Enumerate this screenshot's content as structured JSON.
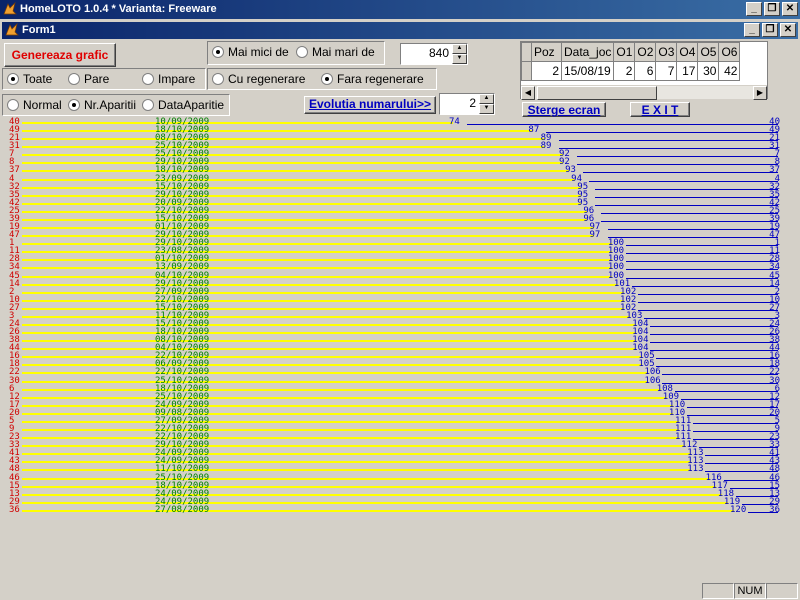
{
  "app": {
    "title": "HomeLOTO 1.0.4 * Varianta: Freeware"
  },
  "form": {
    "title": "Form1"
  },
  "controls": {
    "generate_label": "Genereaza grafic",
    "filter_options": [
      "Toate",
      "Pare",
      "Impare"
    ],
    "compare_options": [
      "Mai mici de",
      "Mai mari de"
    ],
    "threshold_value": "840",
    "regen_options": [
      "Cu regenerare",
      "Fara regenerare"
    ],
    "sort_options": [
      "Normal",
      "Nr.Aparitii",
      "DataAparitie"
    ],
    "evolution_label": "Evolutia numarului>>",
    "evolution_value": "2",
    "clear_label": "Sterge ecran",
    "exit_label": "E X I T"
  },
  "grid": {
    "headers": [
      "Poz",
      "Data_joc",
      "O1",
      "O2",
      "O3",
      "O4",
      "O5",
      "O6"
    ],
    "row": [
      "2",
      "15/08/19",
      "2",
      "6",
      "7",
      "17",
      "30",
      "42"
    ]
  },
  "chart_data": {
    "type": "bar",
    "rows": [
      {
        "n": "40",
        "date": "10/09/2009",
        "count": 74
      },
      {
        "n": "49",
        "date": "18/10/2009",
        "count": 87
      },
      {
        "n": "21",
        "date": "08/10/2009",
        "count": 89
      },
      {
        "n": "31",
        "date": "25/10/2009",
        "count": 89
      },
      {
        "n": "7",
        "date": "25/10/2009",
        "count": 92
      },
      {
        "n": "8",
        "date": "29/10/2009",
        "count": 92
      },
      {
        "n": "37",
        "date": "18/10/2009",
        "count": 93
      },
      {
        "n": "4",
        "date": "23/09/2009",
        "count": 94
      },
      {
        "n": "32",
        "date": "15/10/2009",
        "count": 95
      },
      {
        "n": "35",
        "date": "29/10/2009",
        "count": 95
      },
      {
        "n": "42",
        "date": "20/09/2009",
        "count": 95
      },
      {
        "n": "25",
        "date": "22/10/2009",
        "count": 96
      },
      {
        "n": "39",
        "date": "15/10/2009",
        "count": 96
      },
      {
        "n": "19",
        "date": "01/10/2009",
        "count": 97
      },
      {
        "n": "47",
        "date": "29/10/2009",
        "count": 97
      },
      {
        "n": "1",
        "date": "29/10/2009",
        "count": 100
      },
      {
        "n": "11",
        "date": "23/08/2009",
        "count": 100
      },
      {
        "n": "28",
        "date": "01/10/2009",
        "count": 100
      },
      {
        "n": "34",
        "date": "13/09/2009",
        "count": 100
      },
      {
        "n": "45",
        "date": "04/10/2009",
        "count": 100
      },
      {
        "n": "14",
        "date": "29/10/2009",
        "count": 101
      },
      {
        "n": "2",
        "date": "27/09/2009",
        "count": 102
      },
      {
        "n": "10",
        "date": "22/10/2009",
        "count": 102
      },
      {
        "n": "27",
        "date": "15/10/2009",
        "count": 102
      },
      {
        "n": "3",
        "date": "11/10/2009",
        "count": 103
      },
      {
        "n": "24",
        "date": "15/10/2009",
        "count": 104
      },
      {
        "n": "26",
        "date": "18/10/2009",
        "count": 104
      },
      {
        "n": "38",
        "date": "08/10/2009",
        "count": 104
      },
      {
        "n": "44",
        "date": "04/10/2009",
        "count": 104
      },
      {
        "n": "16",
        "date": "22/10/2009",
        "count": 105
      },
      {
        "n": "18",
        "date": "06/09/2009",
        "count": 105
      },
      {
        "n": "22",
        "date": "22/10/2009",
        "count": 106
      },
      {
        "n": "30",
        "date": "25/10/2009",
        "count": 106
      },
      {
        "n": "6",
        "date": "18/10/2009",
        "count": 108
      },
      {
        "n": "12",
        "date": "25/10/2009",
        "count": 109
      },
      {
        "n": "17",
        "date": "24/09/2009",
        "count": 110
      },
      {
        "n": "20",
        "date": "09/08/2009",
        "count": 110
      },
      {
        "n": "5",
        "date": "27/09/2009",
        "count": 111
      },
      {
        "n": "9",
        "date": "22/10/2009",
        "count": 111
      },
      {
        "n": "23",
        "date": "22/10/2009",
        "count": 111
      },
      {
        "n": "33",
        "date": "29/10/2009",
        "count": 112
      },
      {
        "n": "41",
        "date": "24/09/2009",
        "count": 113
      },
      {
        "n": "43",
        "date": "24/09/2009",
        "count": 113
      },
      {
        "n": "48",
        "date": "11/10/2009",
        "count": 113
      },
      {
        "n": "46",
        "date": "25/10/2009",
        "count": 116
      },
      {
        "n": "15",
        "date": "18/10/2009",
        "count": 117
      },
      {
        "n": "13",
        "date": "24/09/2009",
        "count": 118
      },
      {
        "n": "29",
        "date": "24/09/2009",
        "count": 119
      },
      {
        "n": "36",
        "date": "27/08/2009",
        "count": 120
      }
    ]
  },
  "status": {
    "num": "NUM"
  },
  "colors": {
    "number": "#d00000",
    "date": "#008000",
    "count": "#0000c0",
    "bar": "#ffff00"
  }
}
